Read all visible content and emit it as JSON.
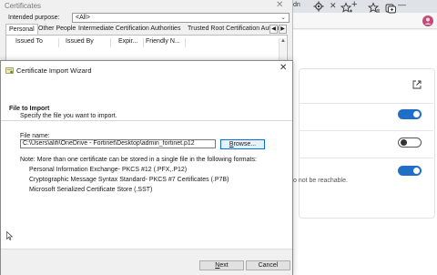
{
  "browser": {
    "tab_fragment": "dn",
    "close_glyph": "✕",
    "new_tab_glyph": "+",
    "minimize_glyph": "—",
    "reach_text": "o not be reachable.",
    "accent": "#1f6fc9"
  },
  "certificates": {
    "title": "Certificates",
    "close_glyph": "✕",
    "purpose_label": "Intended purpose:",
    "purpose_value": "<All>",
    "tabs": [
      "Personal",
      "Other People",
      "Intermediate Certification Authorities",
      "Trusted Root Certification Authori"
    ],
    "tab_scroll_left": "◀",
    "tab_scroll_right": "▶",
    "columns": [
      "Issued To",
      "Issued By",
      "Expir...",
      "Friendly N..."
    ],
    "scroll_up_glyph": "▲"
  },
  "wizard": {
    "title": "Certificate Import Wizard",
    "close_glyph": "✕",
    "heading": "File to Import",
    "subheading": "Specify the file you want to import.",
    "file_label": "File name:",
    "file_value": "C:\\Users\\alifi\\OneDrive - Fortinet\\Desktop\\admin_fortinet.p12",
    "browse_label_underlined": "B",
    "browse_label_rest": "rowse...",
    "note": "Note:  More than one certificate can be stored in a single file in the following formats:",
    "formats": [
      "Personal Information Exchange- PKCS #12 (.PFX,.P12)",
      "Cryptographic Message Syntax Standard- PKCS #7 Certificates (.P7B)",
      "Microsoft Serialized Certificate Store (.SST)"
    ],
    "next_underlined": "N",
    "next_rest": "ext",
    "cancel_label": "Cancel"
  }
}
